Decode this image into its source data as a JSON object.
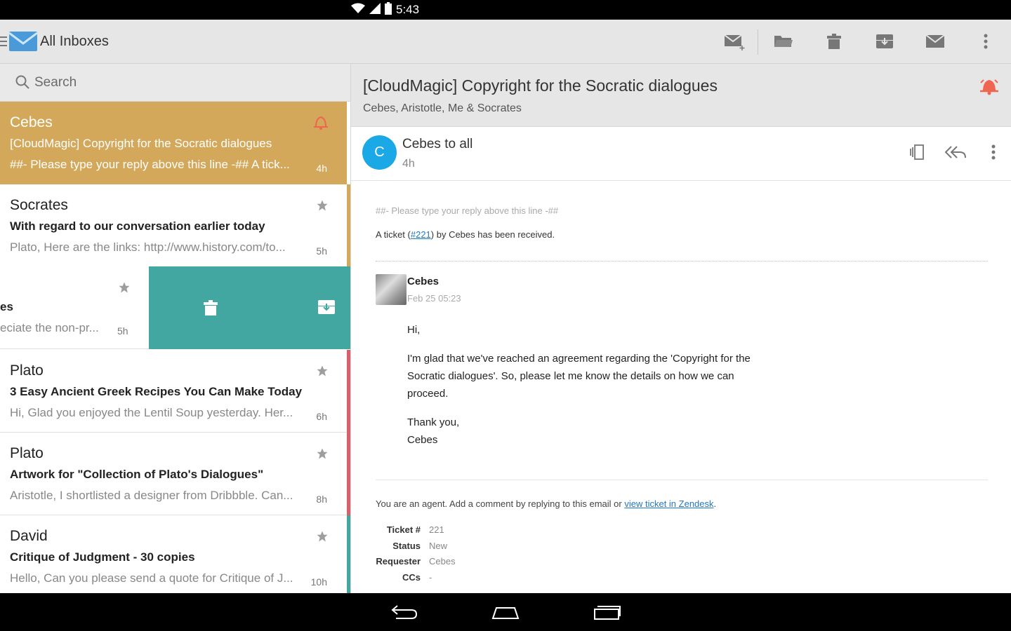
{
  "status_bar": {
    "time": "5:43"
  },
  "app_bar": {
    "title": "All Inboxes"
  },
  "search": {
    "placeholder": "Search"
  },
  "messages": [
    {
      "sender": "Cebes",
      "subject": "[CloudMagic] Copyright for the Socratic dialogues",
      "preview": "##- Please type your reply above this line -## A tick...",
      "time": "4h"
    },
    {
      "sender": "Socrates",
      "subject": "With regard to our conversation earlier today",
      "preview": "Plato, Here are the links: http://www.history.com/to...",
      "time": "5h"
    },
    {
      "sender": "es",
      "preview": "eciate the non-pr...",
      "time": "5h"
    },
    {
      "sender": "Plato",
      "subject": "3 Easy Ancient Greek Recipes You Can Make Today",
      "preview": "Hi, Glad you enjoyed the Lentil Soup yesterday. Her...",
      "time": "6h"
    },
    {
      "sender": "Plato",
      "subject": "Artwork for \"Collection of Plato's Dialogues\"",
      "preview": "Aristotle, I shortlisted a designer from Dribbble. Can...",
      "time": "8h"
    },
    {
      "sender": "David",
      "subject": "Critique of Judgment - 30 copies",
      "preview": "Hello, Can you please send a quote for Critique of J...",
      "time": "10h"
    }
  ],
  "colors": {
    "selected": "#d4a85a",
    "swipe": "#43a7a1",
    "stripe_gold": "#d4a85a",
    "stripe_red": "#d9606a",
    "stripe_teal": "#43a7a1",
    "avatar": "#1aa8e6",
    "bell": "#ef6550"
  },
  "thread": {
    "subject": "[CloudMagic] Copyright for the Socratic dialogues",
    "participants": "Cebes, Aristotle, Me & Socrates",
    "avatar_letter": "C",
    "from": "Cebes to all",
    "ago": "4h"
  },
  "email": {
    "reply_line": "##- Please type your reply above this line -##",
    "ticket_pre": "A ticket (",
    "ticket_link": "#221",
    "ticket_post": ") by Cebes has been received.",
    "commenter": "Cebes",
    "comment_date": "Feb 25 05:23",
    "greeting": "Hi,",
    "paragraph": "I'm glad that we've reached an agreement regarding the 'Copyright for the Socratic dialogues'. So, please let me know the details on how we can proceed.",
    "closing": "Thank you,",
    "signature": "Cebes",
    "agent_text": "You are an agent. Add a comment by replying to this email or ",
    "agent_link": "view ticket in Zendesk",
    "agent_end": ".",
    "meta": [
      {
        "k": "Ticket #",
        "v": "221"
      },
      {
        "k": "Status",
        "v": "New"
      },
      {
        "k": "Requester",
        "v": "Cebes"
      },
      {
        "k": "CCs",
        "v": "-"
      }
    ]
  },
  "icons": [
    "compose-icon",
    "folder-icon",
    "trash-icon",
    "archive-icon",
    "mail-icon",
    "overflow-icon",
    "search-icon",
    "star-icon",
    "bell-icon",
    "reply-all-icon",
    "back-icon",
    "home-icon",
    "recents-icon"
  ]
}
